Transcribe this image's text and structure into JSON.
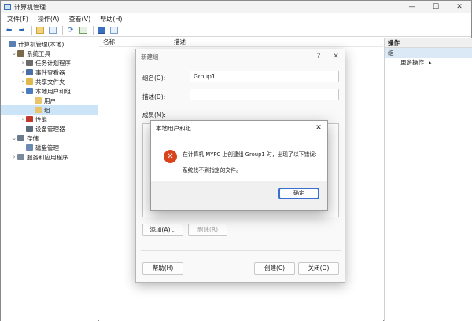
{
  "window": {
    "title": "计算机管理",
    "controls": [
      "—",
      "☐",
      "✕"
    ]
  },
  "menu": [
    "文件(F)",
    "操作(A)",
    "查看(V)",
    "帮助(H)"
  ],
  "tree": {
    "items": [
      {
        "label": "计算机管理(本地)",
        "depth": 0,
        "chev": "",
        "color": "#5a7fb5"
      },
      {
        "label": "系统工具",
        "depth": 1,
        "chev": "v",
        "color": "#7a6a4a"
      },
      {
        "label": "任务计划程序",
        "depth": 2,
        "chev": ">",
        "color": "#6b6b6b"
      },
      {
        "label": "事件查看器",
        "depth": 2,
        "chev": ">",
        "color": "#4a6fa8"
      },
      {
        "label": "共享文件夹",
        "depth": 2,
        "chev": ">",
        "color": "#e0b94c"
      },
      {
        "label": "本地用户和组",
        "depth": 2,
        "chev": "v",
        "color": "#4a7bc0"
      },
      {
        "label": "用户",
        "depth": 3,
        "chev": "",
        "color": "#e9c46a"
      },
      {
        "label": "组",
        "depth": 3,
        "chev": "",
        "color": "#e9c46a",
        "selected": true
      },
      {
        "label": "性能",
        "depth": 2,
        "chev": ">",
        "color": "#c0392b"
      },
      {
        "label": "设备管理器",
        "depth": 2,
        "chev": "",
        "color": "#5b6b7b"
      },
      {
        "label": "存储",
        "depth": 1,
        "chev": "v",
        "color": "#6b7b8b"
      },
      {
        "label": "磁盘管理",
        "depth": 2,
        "chev": "",
        "color": "#6a8ab0"
      },
      {
        "label": "服务和应用程序",
        "depth": 1,
        "chev": ">",
        "color": "#7a8a9a"
      }
    ]
  },
  "center": {
    "columns": [
      "名称",
      "描述"
    ]
  },
  "actions": {
    "header": "操作",
    "group": "组",
    "items": [
      "更多操作"
    ]
  },
  "new_group": {
    "title": "新建组",
    "help": "?",
    "close": "✕",
    "name_label": "组名(G):",
    "name_value": "Group1",
    "desc_label": "描述(D):",
    "desc_value": "",
    "members_label": "成员(M):",
    "add_btn": "添加(A)...",
    "remove_btn": "删除(R)",
    "help_btn": "帮助(H)",
    "create_btn": "创建(C)",
    "close_btn": "关闭(O)"
  },
  "error": {
    "title": "本地用户和组",
    "close": "✕",
    "icon": "✕",
    "message": "在计算机 MYPC 上创建组 Group1 时，出现了以下错误:",
    "detail": "系统找不到指定的文件。",
    "ok_btn": "确定"
  }
}
